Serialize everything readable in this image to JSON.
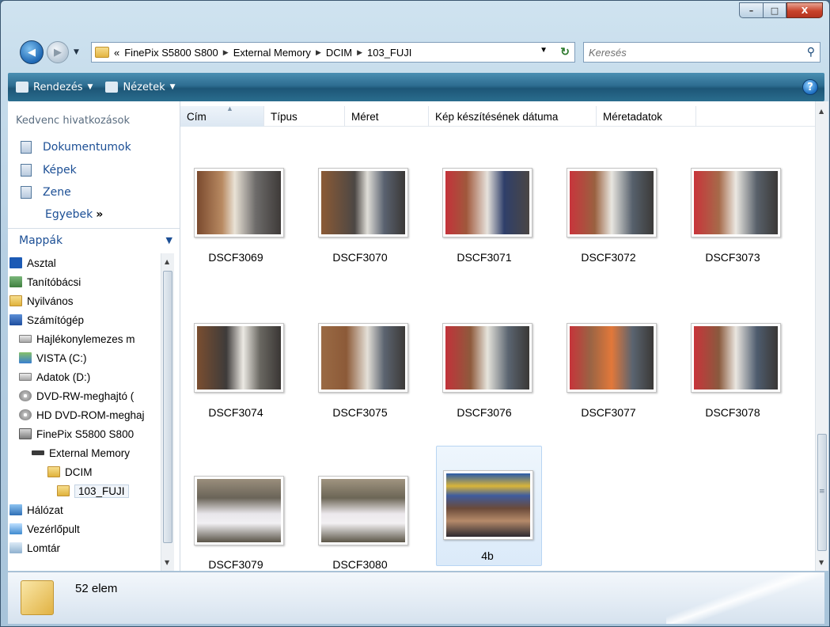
{
  "window": {
    "caption": {
      "minimize": "–",
      "maximize": "□",
      "close": "X"
    }
  },
  "address": {
    "chevron": "«",
    "crumbs": [
      "FinePix S5800 S800",
      "External Memory",
      "DCIM",
      "103_FUJI"
    ],
    "search_placeholder": "Keresés"
  },
  "toolbar": {
    "organize": "Rendezés",
    "views": "Nézetek",
    "help": "?"
  },
  "favorites": {
    "heading": "Kedvenc hivatkozások",
    "items": [
      "Dokumentumok",
      "Képek",
      "Zene"
    ],
    "more": "Egyebek",
    "more_arrow": "»"
  },
  "folders": {
    "heading": "Mappák",
    "tree": [
      {
        "label": "Asztal",
        "icon": "desktop-icon"
      },
      {
        "label": "Tanítóbácsi",
        "icon": "user-folder-icon"
      },
      {
        "label": "Nyilvános",
        "icon": "folder-icon"
      },
      {
        "label": "Számítógép",
        "icon": "computer-icon"
      },
      {
        "label": "Hajlékonylemezes m",
        "icon": "floppy-drive-icon"
      },
      {
        "label": "VISTA (C:)",
        "icon": "system-drive-icon"
      },
      {
        "label": "Adatok (D:)",
        "icon": "drive-icon"
      },
      {
        "label": "DVD-RW-meghajtó (",
        "icon": "dvd-drive-icon"
      },
      {
        "label": "HD DVD-ROM-meghaj",
        "icon": "dvd-drive-icon"
      },
      {
        "label": "FinePix S5800 S800",
        "icon": "camera-icon"
      },
      {
        "label": "External Memory",
        "icon": "memory-card-icon"
      },
      {
        "label": "DCIM",
        "icon": "folder-icon"
      },
      {
        "label": "103_FUJI",
        "icon": "folder-icon"
      },
      {
        "label": "Hálózat",
        "icon": "network-icon"
      },
      {
        "label": "Vezérlőpult",
        "icon": "control-panel-icon"
      },
      {
        "label": "Lomtár",
        "icon": "recycle-bin-icon"
      }
    ]
  },
  "columns": [
    "Cím",
    "Típus",
    "Méret",
    "Kép készítésének dátuma",
    "Méretadatok"
  ],
  "files": [
    {
      "name": "DSCF3069"
    },
    {
      "name": "DSCF3070"
    },
    {
      "name": "DSCF3071"
    },
    {
      "name": "DSCF3072"
    },
    {
      "name": "DSCF3073"
    },
    {
      "name": "DSCF3074"
    },
    {
      "name": "DSCF3075"
    },
    {
      "name": "DSCF3076"
    },
    {
      "name": "DSCF3077"
    },
    {
      "name": "DSCF3078"
    },
    {
      "name": "DSCF3079"
    },
    {
      "name": "DSCF3080"
    },
    {
      "name": "4b"
    }
  ],
  "details": {
    "count_text": "52 elem"
  },
  "colors": {
    "toolbar": "#2d6c90",
    "link": "#1c4f95",
    "selection": "#dbeaf9"
  }
}
